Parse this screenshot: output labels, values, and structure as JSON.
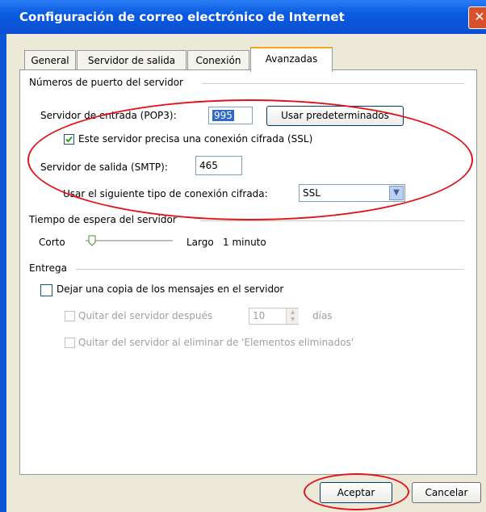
{
  "window": {
    "title": "Configuración de correo electrónico de Internet"
  },
  "tabs": [
    "General",
    "Servidor de salida",
    "Conexión",
    "Avanzadas"
  ],
  "active_tab": "Avanzadas",
  "ports": {
    "group_label": "Números de puerto del servidor",
    "incoming_label": "Servidor de entrada (POP3):",
    "incoming_value": "995",
    "defaults_button": "Usar predeterminados",
    "ssl_checkbox_label": "Este servidor precisa una conexión cifrada (SSL)",
    "ssl_checked": true,
    "outgoing_label": "Servidor de salida (SMTP):",
    "outgoing_value": "465",
    "encryption_label": "Usar el siguiente tipo de conexión cifrada:",
    "encryption_value": "SSL"
  },
  "timeout": {
    "group_label": "Tiempo de espera del servidor",
    "short_label": "Corto",
    "long_label": "Largo",
    "value_label": "1 minuto",
    "slider_level": 0.03
  },
  "delivery": {
    "group_label": "Entrega",
    "keep_copy_label": "Dejar una copia de los mensajes en el servidor",
    "keep_copy_checked": false,
    "remove_after_label": "Quitar del servidor después",
    "remove_after_value": "10",
    "days_label": "días",
    "remove_on_delete_label": "Quitar del servidor al eliminar de 'Elementos eliminados'"
  },
  "buttons": {
    "ok": "Aceptar",
    "cancel": "Cancelar"
  },
  "colors": {
    "title_bar": "#0b4fd1",
    "highlight_ellipse": "#e0141c",
    "active_tab_accent": "#f5a623"
  }
}
